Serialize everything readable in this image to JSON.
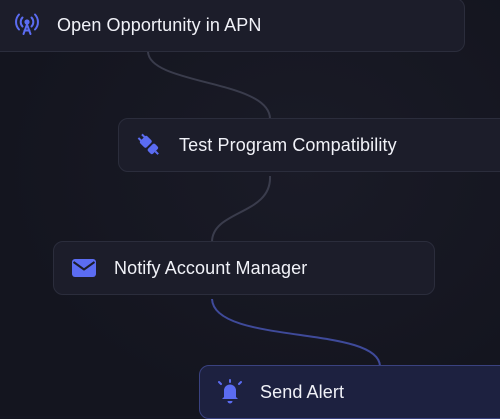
{
  "workflow": {
    "nodes": [
      {
        "label": "Open Opportunity in APN",
        "icon": "broadcast-antenna-icon"
      },
      {
        "label": "Test Program Compatibility",
        "icon": "plug-icon"
      },
      {
        "label": "Notify Account Manager",
        "icon": "envelope-icon"
      },
      {
        "label": "Send Alert",
        "icon": "bell-alert-icon"
      }
    ]
  },
  "colors": {
    "background": "#151621",
    "node_bg": "#1c1d2a",
    "node_border": "#2b2d3c",
    "active_node_bg": "#1d2140",
    "active_node_border": "#3a4280",
    "icon_accent": "#5b6cf2",
    "connector": "#3a3c4c",
    "active_connector": "#3f4a9a",
    "text": "#f1f2f8"
  }
}
